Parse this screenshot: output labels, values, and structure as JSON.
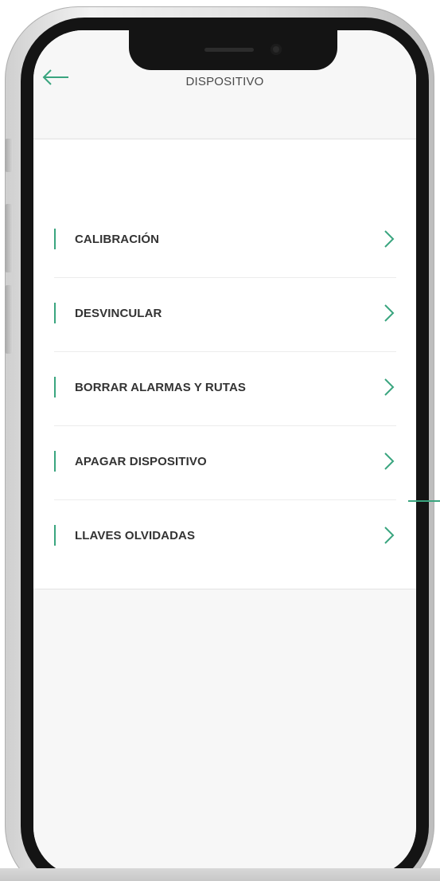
{
  "header": {
    "title": "DISPOSITIVO",
    "back_icon": "back-arrow-icon"
  },
  "menu": {
    "items": [
      {
        "label": "CALIBRACIÓN"
      },
      {
        "label": "DESVINCULAR"
      },
      {
        "label": "BORRAR ALARMAS Y RUTAS"
      },
      {
        "label": "APAGAR DISPOSITIVO"
      },
      {
        "label": "LLAVES OLVIDADAS"
      }
    ],
    "item_icon": "chevron-right-icon"
  },
  "colors": {
    "accent": "#3aa57f",
    "label_text": "#333333",
    "title_text": "#4a4a4a",
    "background": "#f7f7f7"
  }
}
